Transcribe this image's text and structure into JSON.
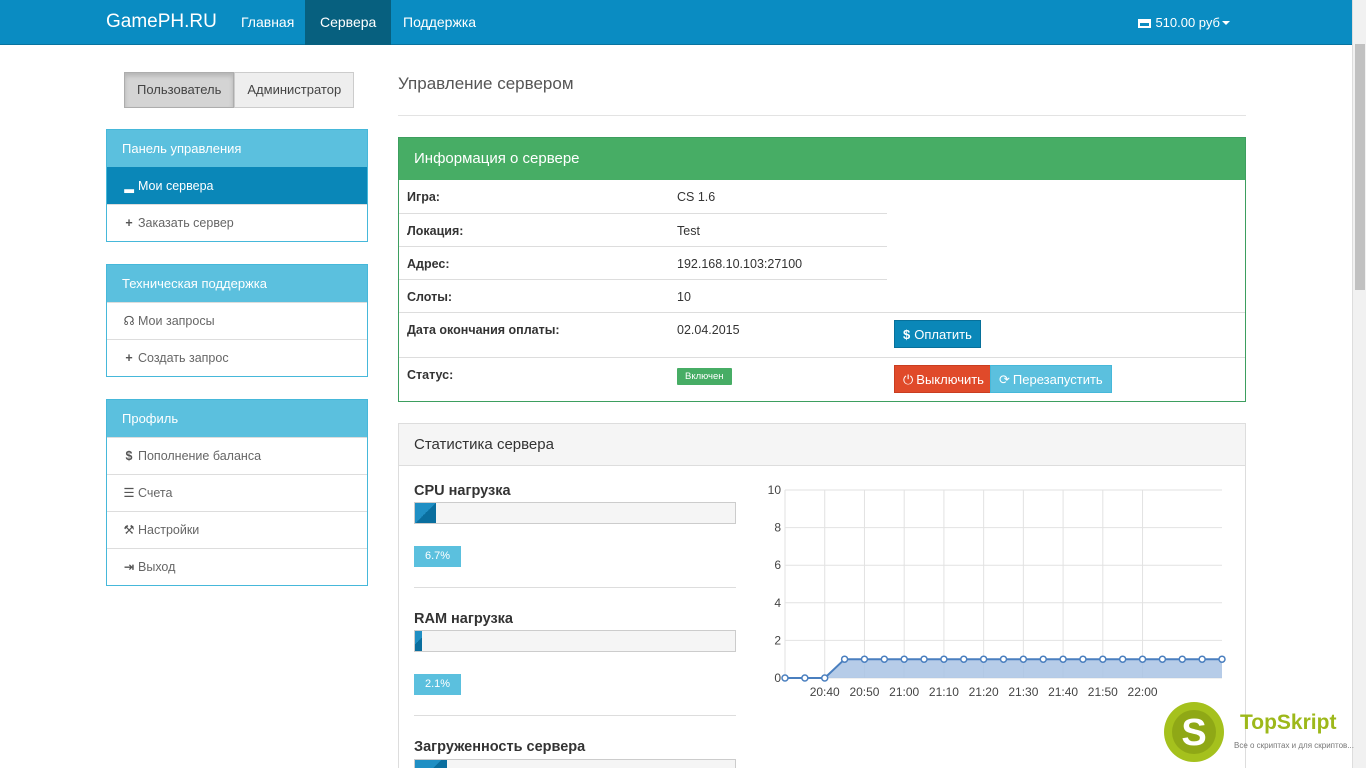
{
  "navbar": {
    "brand": "GamePH.RU",
    "links": [
      "Главная",
      "Сервера",
      "Поддержка"
    ],
    "balance": "510.00 руб"
  },
  "role_toggle": {
    "user": "Пользователь",
    "admin": "Администратор"
  },
  "sidebar": {
    "control": {
      "title": "Панель управления",
      "items": [
        "Мои сервера",
        "Заказать сервер"
      ]
    },
    "support": {
      "title": "Техническая поддержка",
      "items": [
        "Мои запросы",
        "Создать запрос"
      ]
    },
    "profile": {
      "title": "Профиль",
      "items": [
        "Пополнение баланса",
        "Счета",
        "Настройки",
        "Выход"
      ]
    }
  },
  "page_title": "Управление сервером",
  "server_info": {
    "title": "Информация о сервере",
    "rows": [
      {
        "label": "Игра:",
        "value": "CS 1.6"
      },
      {
        "label": "Локация:",
        "value": "Test"
      },
      {
        "label": "Адрес:",
        "value": "192.168.10.103:27100"
      },
      {
        "label": "Слоты:",
        "value": "10"
      },
      {
        "label": "Дата окончания оплаты:",
        "value": "02.04.2015"
      }
    ],
    "status_label": "Статус:",
    "status_value": "Включен",
    "pay_button": "Оплатить",
    "stop_button": "Выключить",
    "restart_button": "Перезапустить",
    "colors": {
      "header": "#47ad65",
      "pay": "#0a87b8",
      "stop": "#e04a2a",
      "restart": "#5bc0de"
    }
  },
  "stats": {
    "title": "Статистика сервера",
    "cpu": {
      "title": "CPU нагрузка",
      "percent": 6.7,
      "label": "6.7%"
    },
    "ram": {
      "title": "RAM нагрузка",
      "percent": 2.1,
      "label": "2.1%"
    },
    "load": {
      "title": "Загруженность сервера",
      "percent": 10
    }
  },
  "chart_data": {
    "type": "area",
    "x": [
      "20:30",
      "20:35",
      "20:40",
      "20:45",
      "20:50",
      "20:55",
      "21:00",
      "21:05",
      "21:10",
      "21:15",
      "21:20",
      "21:25",
      "21:30",
      "21:35",
      "21:40",
      "21:45",
      "21:50",
      "21:55",
      "22:00",
      "22:05",
      "22:10",
      "22:15",
      "22:20"
    ],
    "values": [
      0,
      0,
      0,
      1,
      1,
      1,
      1,
      1,
      1,
      1,
      1,
      1,
      1,
      1,
      1,
      1,
      1,
      1,
      1,
      1,
      1,
      1,
      1
    ],
    "x_tick_labels": [
      "20:40",
      "20:50",
      "21:00",
      "21:10",
      "21:20",
      "21:30",
      "21:40",
      "21:50",
      "22:00"
    ],
    "y_ticks": [
      0,
      2,
      4,
      6,
      8,
      10
    ],
    "ylim": [
      0,
      10
    ],
    "grid": true,
    "color": "#4a7fbf"
  },
  "watermark": {
    "name": "TopSkript",
    "tagline": "Все о скриптах и для скриптов..."
  }
}
